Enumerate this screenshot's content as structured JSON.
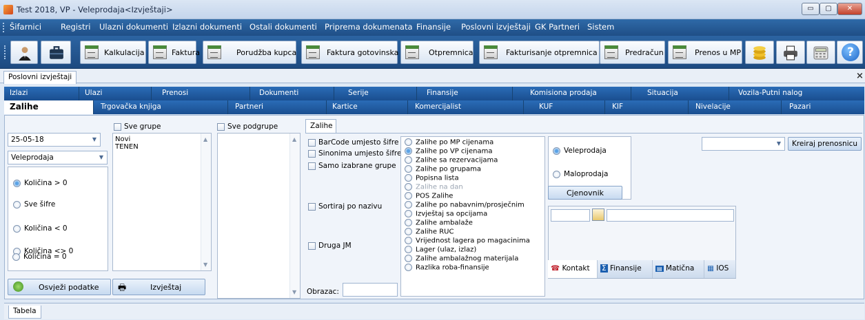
{
  "window": {
    "title": "Test 2018, VP - Veleprodaja<Izvještaji>",
    "controls": {
      "minimize": "▭",
      "maximize": "▢",
      "close": "✕"
    }
  },
  "menu": [
    "Šifarnici",
    "Registri",
    "Ulazni dokumenti",
    "Izlazni dokumenti",
    "Ostali dokumenti",
    "Priprema dokumenata",
    "Finansije",
    "Poslovni izvještaji",
    "GK Partneri",
    "Sistem"
  ],
  "toolbar": {
    "icons": [
      "user-icon",
      "briefcase-icon"
    ],
    "buttons": [
      "Kalkulacija",
      "Faktura",
      "Porudžba kupca",
      "Faktura gotovinska",
      "Otpremnica",
      "Fakturisanje otpremnica",
      "Predračun",
      "Prenos u MP"
    ],
    "right_icons": [
      "coins-icon",
      "printer-icon",
      "calculator-icon",
      "help-icon"
    ],
    "help_glyph": "?"
  },
  "doc_tab": {
    "label": "Poslovni izvještaji",
    "close": "×"
  },
  "category_tabs_row1": [
    "Izlazi",
    "Ulazi",
    "Prenosi",
    "Dokumenti",
    "Serije",
    "Finansije",
    "Komisiona prodaja",
    "Situacija",
    "Vozila-Putni nalog"
  ],
  "category_tabs_row2": [
    "Zalihe",
    "Trgovačka knjiga",
    "Partneri",
    "Kartice",
    "Komercijalist",
    "KUF",
    "KIF",
    "Nivelacije",
    "Pazari"
  ],
  "active_category": "Zalihe",
  "filters": {
    "date": "25-05-18",
    "warehouse": "Veleprodaja",
    "quantity_options": [
      "Količina > 0",
      "Sve šifre",
      "Količina < 0",
      "Količina <> 0",
      "Količina = 0"
    ],
    "selected_quantity": "Količina > 0",
    "refresh_button": "Osvježi podatke",
    "report_button": "Izvještaj"
  },
  "groups": {
    "label": "Sve grupe",
    "items": [
      "Novi",
      "TENEN"
    ]
  },
  "subgroups": {
    "label": "Sve podgrupe",
    "items": []
  },
  "zalihe_tab": {
    "label": "Zalihe",
    "checks": [
      "BarCode umjesto šifre",
      "Sinonima umjesto šifre",
      "Samo izabrane grupe",
      "Sortiraj po nazivu",
      "Druga JM"
    ],
    "obrazac_label": "Obrazac:",
    "report_types": [
      "Zalihe po MP cijenama",
      "Zalihe po VP cijenama",
      "Zalihe sa rezervacijama",
      "Zalihe po grupama",
      "Popisna lista",
      "Zalihe na dan",
      "POS Zalihe",
      "Zalihe po nabavnim/prosječnim",
      "Izvještaj sa opcijama",
      "Zalihe ambalaže",
      "Zalihe RUC",
      "Vrijednost lagera po magacinima",
      "Lager (ulaz, izlaz)",
      "Zalihe ambalažnog materijala",
      "Razlika roba-finansije"
    ],
    "selected_report": "Zalihe po VP cijenama",
    "disabled_report": "Zalihe na dan"
  },
  "price_type": {
    "options": [
      "Veleprodaja",
      "Maloprodaja"
    ],
    "selected": "Veleprodaja",
    "cjenovnik_button": "Cjenovnik"
  },
  "partner_tabs": [
    "Kontakt",
    "Finansije",
    "Matična",
    "IOS"
  ],
  "create_button": "Kreiraj prenosnicu",
  "bottom_tab": "Tabela",
  "colors": {
    "menu_bg": "#1f4e86",
    "tab_active": "#ffffff",
    "accent_radio": "#5aa2e6"
  }
}
